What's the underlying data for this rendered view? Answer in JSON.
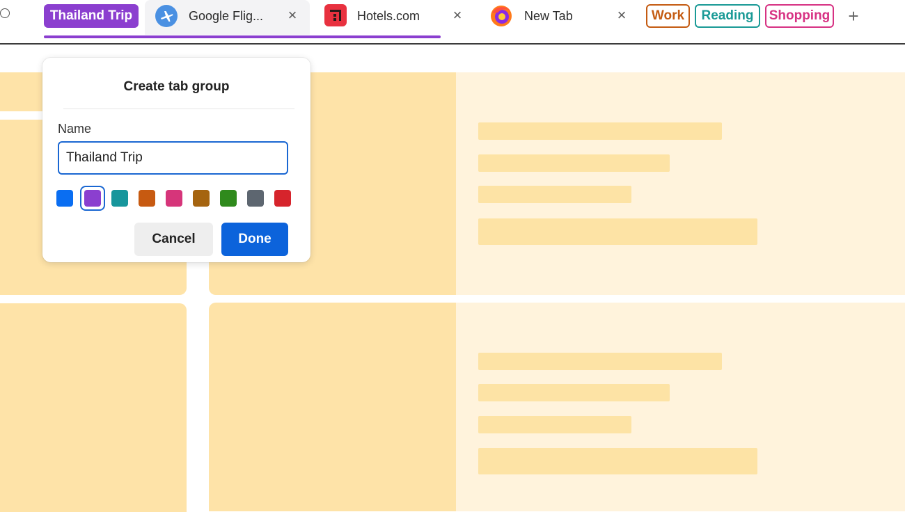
{
  "tabstrip": {
    "active_group": {
      "label": "Thailand Trip",
      "color": "#8b3fcf"
    },
    "tabs": [
      {
        "title": "Google Flig...",
        "icon": "airplane-icon",
        "close": "×"
      },
      {
        "title": "Hotels.com",
        "icon": "hotels-icon",
        "close": "×"
      },
      {
        "title": "New Tab",
        "icon": "firefox-icon",
        "close": "×"
      }
    ],
    "groups": [
      {
        "label": "Work",
        "color": "#c45b12"
      },
      {
        "label": "Reading",
        "color": "#1a9a96"
      },
      {
        "label": "Shopping",
        "color": "#d73283"
      }
    ],
    "new_tab": "+"
  },
  "popover": {
    "title": "Create tab group",
    "name_label": "Name",
    "name_value": "Thailand Trip",
    "colors": [
      "#0a6ef2",
      "#8b3fcf",
      "#17969c",
      "#c75a11",
      "#d6357a",
      "#a56410",
      "#2f8a1c",
      "#5d6670",
      "#d6242c"
    ],
    "selected_color_index": 1,
    "cancel_label": "Cancel",
    "done_label": "Done"
  }
}
